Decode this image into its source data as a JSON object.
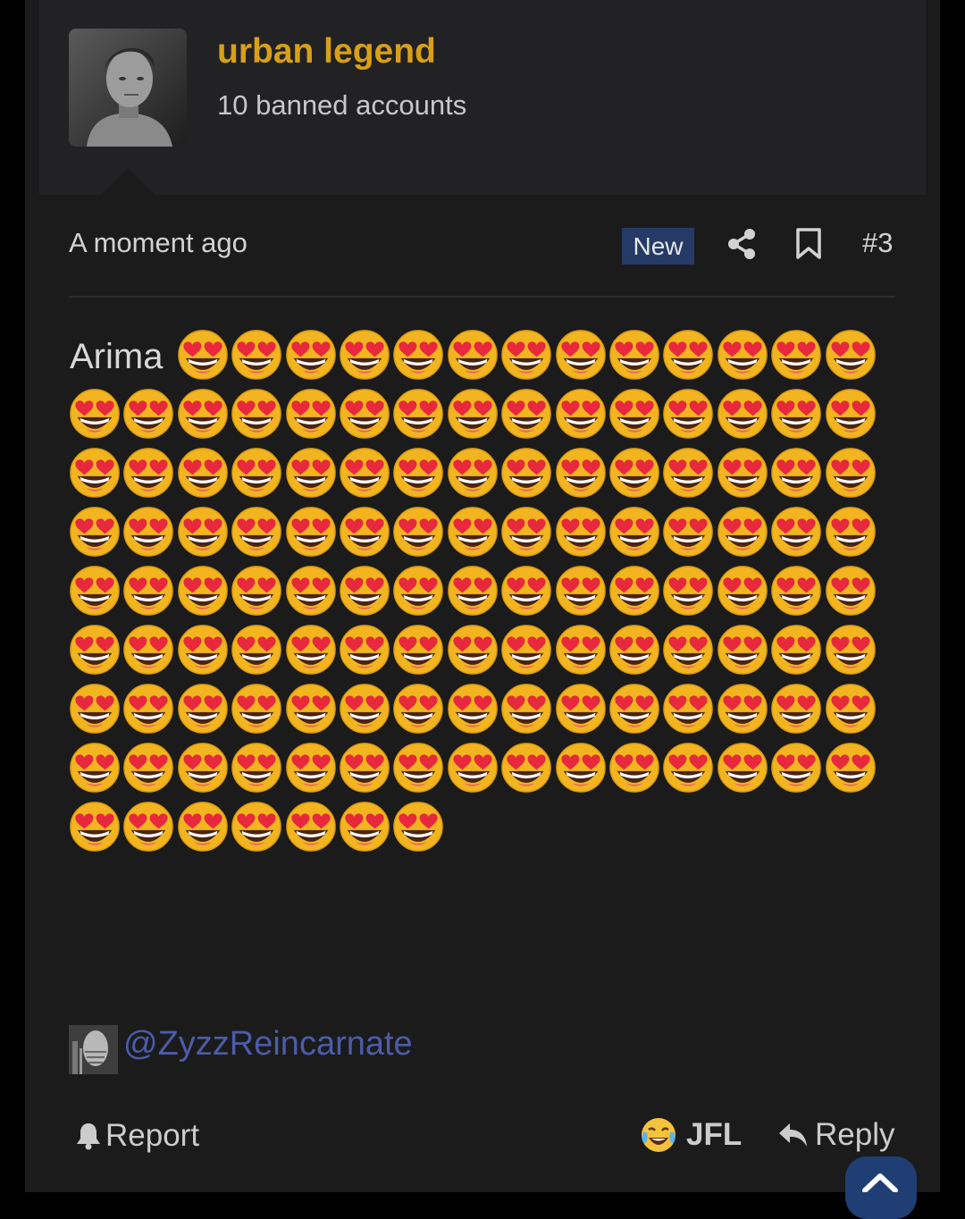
{
  "user": {
    "name": "urban legend",
    "title": "10 banned accounts"
  },
  "meta": {
    "time": "A moment ago",
    "badge": "New",
    "post_number": "#3"
  },
  "message": {
    "text": "Arima",
    "emoji_name": "smiling-face-with-heart-eyes",
    "emoji_count": 125,
    "mention": "@ZyzzReincarnate"
  },
  "actions": {
    "report": "Report",
    "reaction": "JFL",
    "reply": "Reply"
  },
  "colors": {
    "username": "#d8a018",
    "badge_bg": "#253a66",
    "mention": "#4b5ca8",
    "post_bg": "#1b1b1c",
    "header_bg": "#222224"
  }
}
